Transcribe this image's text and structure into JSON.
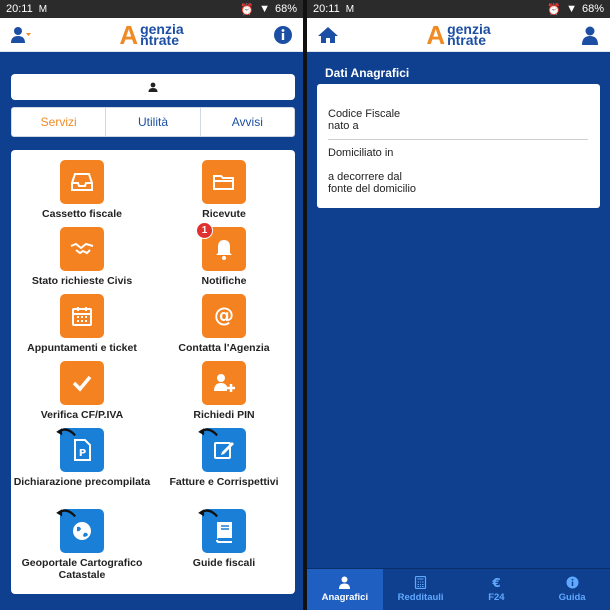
{
  "status": {
    "time": "20:11",
    "battery": "68%"
  },
  "logo": {
    "line1": "genzia",
    "line2": "ntrate",
    "letter": "A"
  },
  "left": {
    "tabs": [
      {
        "label": "Servizi",
        "active": true
      },
      {
        "label": "Utilità",
        "active": false
      },
      {
        "label": "Avvisi",
        "active": false
      }
    ],
    "items": [
      {
        "label": "Cassetto fiscale",
        "icon": "inbox-tray-icon",
        "color": "#f58220"
      },
      {
        "label": "Ricevute",
        "icon": "folder-icon",
        "color": "#f58220"
      },
      {
        "label": "Stato richieste Civis",
        "icon": "handshake-icon",
        "color": "#f58220"
      },
      {
        "label": "Notifiche",
        "icon": "bell-icon",
        "color": "#f58220",
        "badge": "1"
      },
      {
        "label": "Appuntamenti e ticket",
        "icon": "calendar-icon",
        "color": "#f58220"
      },
      {
        "label": "Contatta l'Agenzia",
        "icon": "at-sign-icon",
        "color": "#f58220"
      },
      {
        "label": "Verifica CF/P.IVA",
        "icon": "checkmark-icon",
        "color": "#f58220"
      },
      {
        "label": "Richiedi PIN",
        "icon": "user-add-icon",
        "color": "#f58220"
      },
      {
        "label": "Dichiarazione precompilata",
        "icon": "document-p-icon",
        "color": "#1a7fd6"
      },
      {
        "label": "Fatture e Corrispettivi",
        "icon": "edit-icon",
        "color": "#1a7fd6"
      },
      {
        "label": "Geoportale Cartografico Catastale",
        "icon": "globe-icon",
        "color": "#1a7fd6"
      },
      {
        "label": "Guide fiscali",
        "icon": "book-icon",
        "color": "#1a7fd6"
      }
    ]
  },
  "right": {
    "section_title": "Dati Anagrafici",
    "card": {
      "codice_fiscale": "Codice Fiscale",
      "nato_a": "nato a",
      "domiciliato": "Domiciliato in",
      "decorrere": "a decorrere dal",
      "fonte": "fonte del domicilio"
    },
    "nav": [
      {
        "label": "Anagrafici",
        "icon": "person-icon",
        "active": true
      },
      {
        "label": "Redditauli",
        "icon": "calculator-icon",
        "active": false
      },
      {
        "label": "F24",
        "icon": "euro-icon",
        "active": false
      },
      {
        "label": "Guida",
        "icon": "info-icon",
        "active": false
      }
    ]
  },
  "colors": {
    "brand_blue": "#0f3f8f",
    "accent_orange": "#f58220",
    "tile_blue": "#1a7fd6",
    "active_nav": "#1f5fc2"
  }
}
